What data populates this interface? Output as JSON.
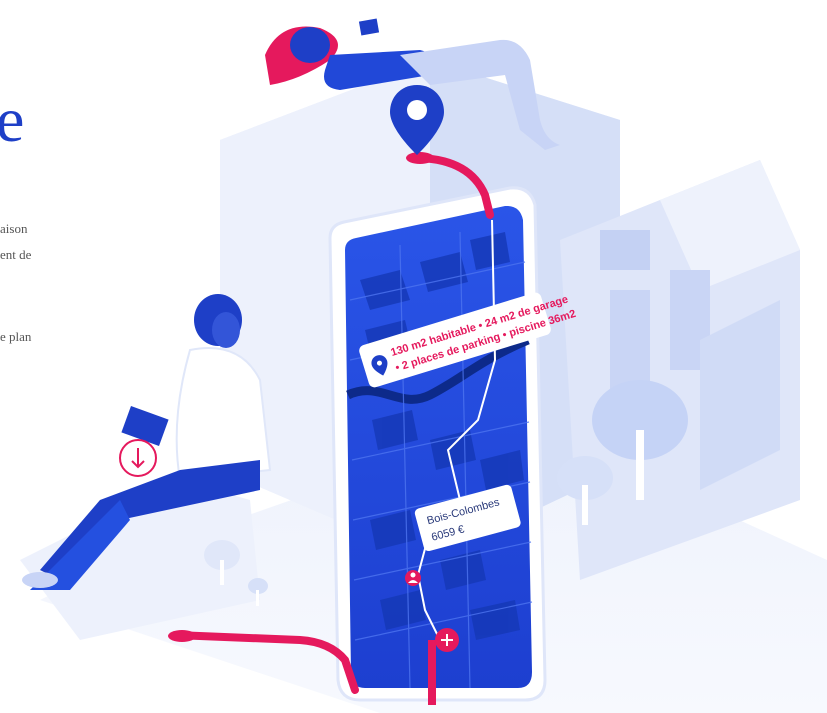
{
  "heading_fragment": "e",
  "text_fragments": [
    "aison",
    "ent de",
    "e plan"
  ],
  "property_tag": {
    "line1": "130 m2 habitable • 24 m2 de garage",
    "line2": "• 2 places de parking • piscine 36m2"
  },
  "location_label": {
    "city": "Bois-Colombes",
    "price": "6059 €"
  },
  "colors": {
    "primary_blue": "#1e3fc7",
    "accent_pink": "#e5195d",
    "light_building": "#e6ecfb"
  },
  "icons": [
    "map-pin-icon",
    "location-pin-icon",
    "download-icon",
    "add-icon",
    "person-icon"
  ]
}
